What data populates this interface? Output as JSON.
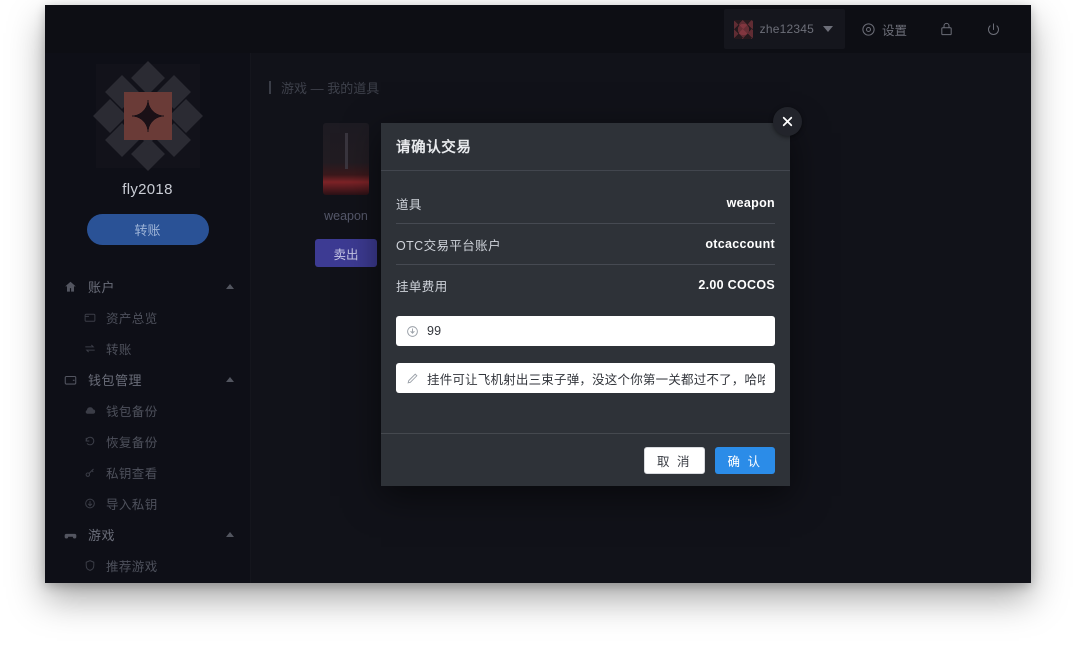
{
  "header": {
    "user": {
      "name": "zhe12345",
      "avatar_icon": "identicon-avatar",
      "chevron_icon": "chevron-down-icon"
    },
    "settings_label": "设置",
    "settings_icon": "gear-icon",
    "lock_icon": "lock-icon",
    "power_icon": "power-icon"
  },
  "sidebar": {
    "brand": {
      "avatar_icon": "identicon-avatar",
      "name": "fly2018",
      "transfer_button": "转账"
    },
    "nav": [
      {
        "type": "group",
        "label": "账户",
        "icon": "home-icon",
        "caret": "chevron-up-icon"
      },
      {
        "type": "item",
        "label": "资产总览",
        "icon": "wallet-overview-icon"
      },
      {
        "type": "item",
        "label": "转账",
        "icon": "transfer-icon"
      },
      {
        "type": "group",
        "label": "钱包管理",
        "icon": "wallet-icon",
        "caret": "chevron-up-icon"
      },
      {
        "type": "item",
        "label": "钱包备份",
        "icon": "cloud-backup-icon"
      },
      {
        "type": "item",
        "label": "恢复备份",
        "icon": "restore-icon"
      },
      {
        "type": "item",
        "label": "私钥查看",
        "icon": "key-icon"
      },
      {
        "type": "item",
        "label": "导入私钥",
        "icon": "import-icon"
      },
      {
        "type": "group",
        "label": "游戏",
        "icon": "gamepad-icon",
        "caret": "chevron-up-icon"
      },
      {
        "type": "item",
        "label": "推荐游戏",
        "icon": "shield-icon"
      }
    ]
  },
  "content": {
    "breadcrumb": "游戏 —  我的道具",
    "item": {
      "name": "weapon",
      "sell_button": "卖出"
    }
  },
  "modal": {
    "title": "请确认交易",
    "close_icon": "close-icon",
    "rows": [
      {
        "key": "道具",
        "value": "weapon"
      },
      {
        "key": "OTC交易平台账户",
        "value": "otcaccount"
      },
      {
        "key": "挂单费用",
        "value": "2.00 COCOS"
      }
    ],
    "price_field": {
      "icon": "coin-icon",
      "value": "99",
      "placeholder": "请输入价格"
    },
    "memo_field": {
      "icon": "pencil-icon",
      "value": "挂件可让飞机射出三束子弹，没这个你第一关都过不了，哈哈",
      "placeholder": "请输入描述"
    },
    "cancel_label": "取 消",
    "confirm_label": "确 认"
  },
  "colors": {
    "window_bg": "#0d0e14",
    "sidebar_bg": "#0e0f17",
    "content_bg": "#111219",
    "modal_bg": "#2e3238",
    "accent_blue": "#2b8ce8",
    "transfer_blue": "#2a5296",
    "sell_purple": "#3d3b93"
  }
}
